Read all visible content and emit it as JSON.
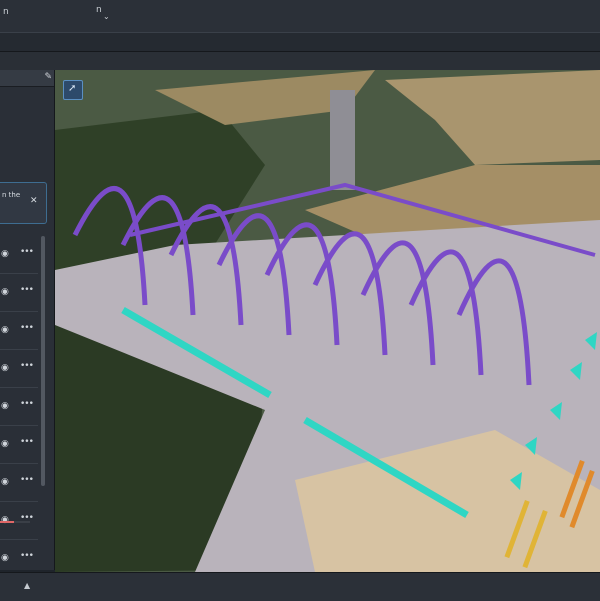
{
  "app": {
    "title_fragment": "n",
    "menu_caret": "⌄"
  },
  "sidebar": {
    "pin_icon": "pin-icon",
    "notice": {
      "text": "n the",
      "close": "✕"
    },
    "layers": [
      {
        "visibility_icon": "eye-icon",
        "menu": "•••"
      },
      {
        "visibility_icon": "eye-icon",
        "menu": "•••"
      },
      {
        "visibility_icon": "eye-icon",
        "menu": "•••"
      },
      {
        "visibility_icon": "eye-icon",
        "menu": "•••"
      },
      {
        "visibility_icon": "eye-icon",
        "menu": "•••"
      },
      {
        "visibility_icon": "eye-icon",
        "menu": "•••"
      },
      {
        "visibility_icon": "eye-icon",
        "menu": "•••"
      },
      {
        "visibility_icon": "eye-icon",
        "menu": "•••"
      },
      {
        "visibility_icon": "eye-icon",
        "menu": "•••"
      },
      {
        "visibility_icon": "eye-icon",
        "menu": "•••"
      }
    ],
    "progress_fraction": 0.45,
    "progress_color": "#e06767"
  },
  "viewport": {
    "tool_icon": "cursor-icon",
    "colors": {
      "arches": "#7a4cc9",
      "cyan": "#2fd6c4",
      "yellow": "#e0b437",
      "orange": "#e08a2c",
      "ground": "#c9c3c8",
      "forest": "#2f4027",
      "field": "#b7a47e"
    }
  },
  "status": {
    "icon": "chevron-up-icon"
  }
}
